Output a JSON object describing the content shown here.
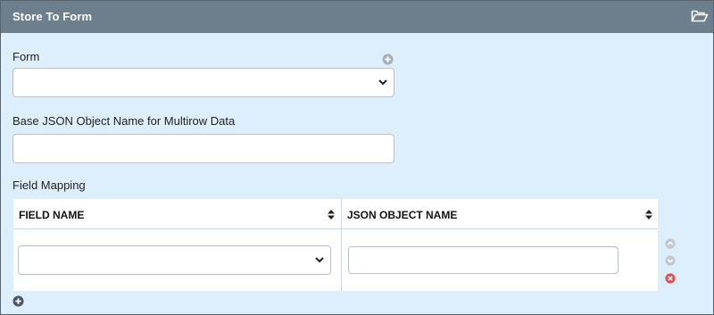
{
  "header": {
    "title": "Store To Form",
    "icon": "folder-open-icon"
  },
  "form_field": {
    "label": "Form",
    "value": "",
    "add_icon": "plus-circle-icon"
  },
  "base_json": {
    "label": "Base JSON Object Name for Multirow Data",
    "value": ""
  },
  "mapping": {
    "label": "Field Mapping",
    "columns": [
      {
        "label": "FIELD NAME"
      },
      {
        "label": "JSON OBJECT NAME"
      }
    ],
    "rows": [
      {
        "field_name": "",
        "json_object_name": ""
      }
    ],
    "row_actions": [
      "move-up-icon",
      "move-down-icon",
      "remove-icon"
    ],
    "add_row_icon": "plus-circle-icon"
  },
  "colors": {
    "header_bg": "#6d7f8c",
    "panel_bg": "#ddeefd",
    "remove_red": "#e05252",
    "muted_grey": "#c3c8cc"
  }
}
